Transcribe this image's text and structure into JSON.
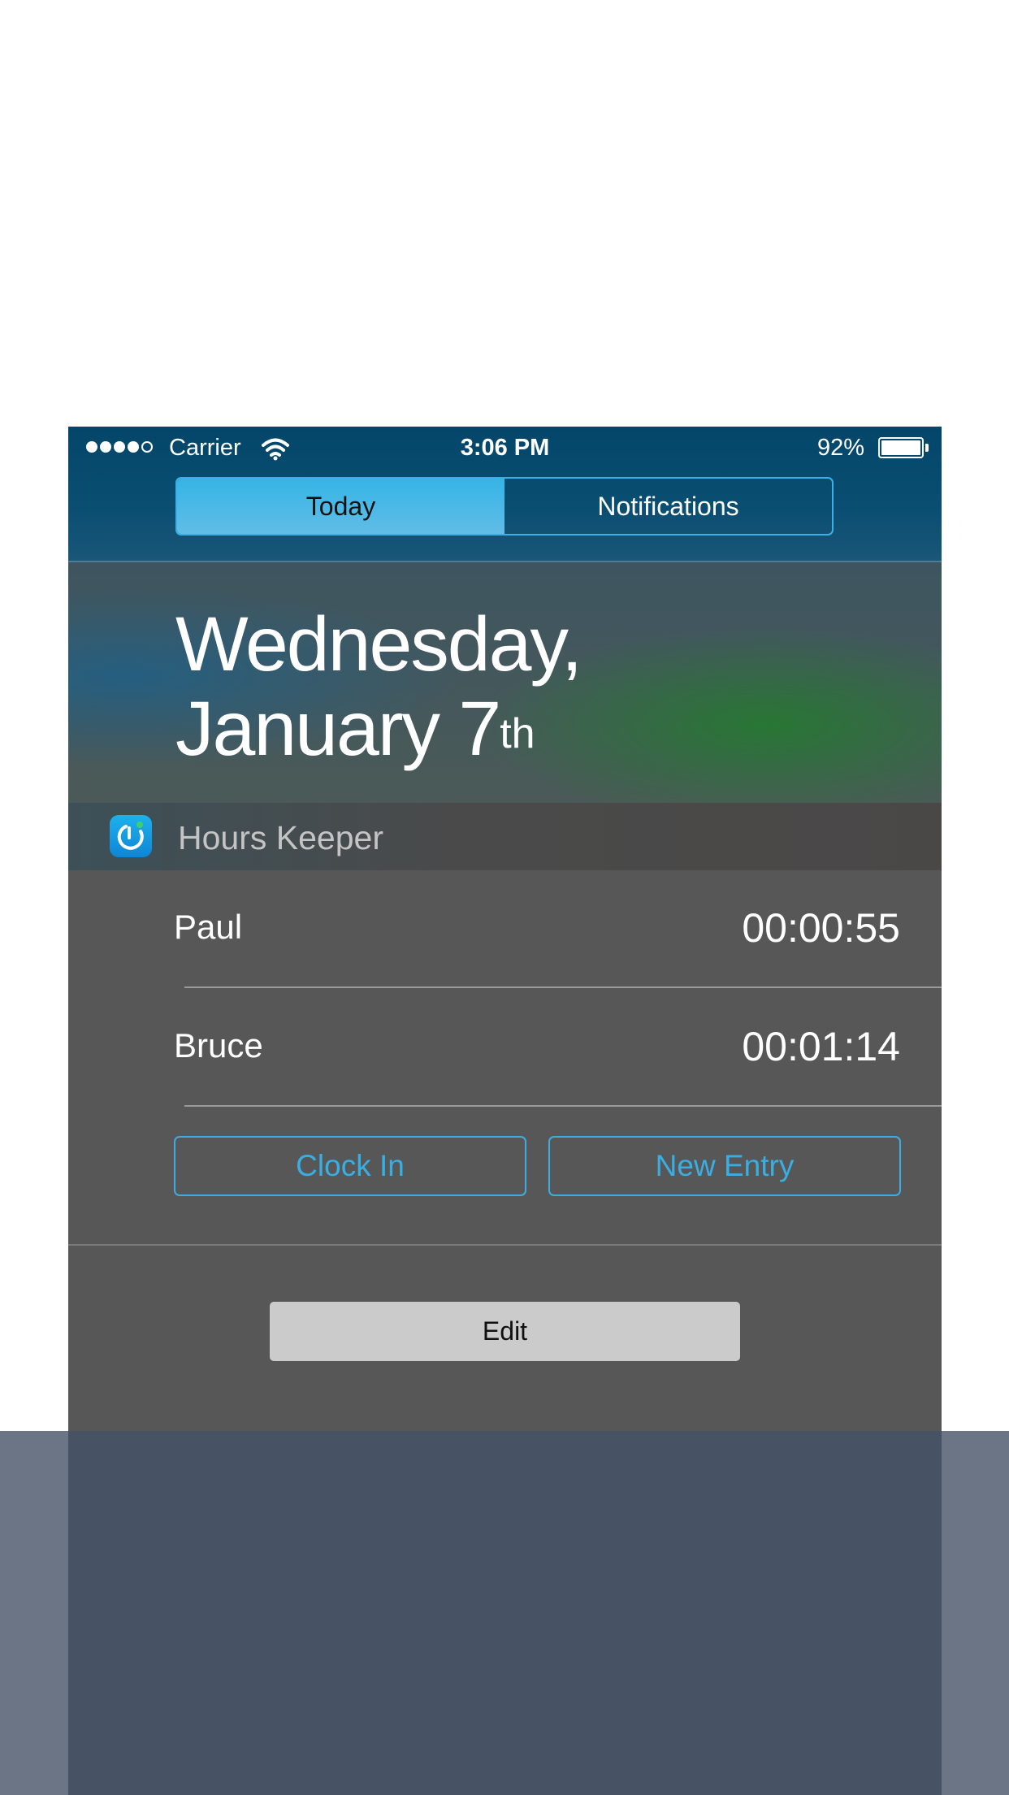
{
  "status_bar": {
    "carrier": "Carrier",
    "time": "3:06 PM",
    "battery": "92%",
    "battery_level_fraction": 0.92,
    "signal_bars": 4,
    "signal_max": 5,
    "icons": [
      "signal-dots-icon",
      "wifi-icon",
      "battery-icon"
    ]
  },
  "segments": {
    "today": "Today",
    "notifications": "Notifications",
    "selected": "Today"
  },
  "date": {
    "line1": "Wednesday,",
    "line2": "January 7",
    "suffix": "th"
  },
  "widget": {
    "app_name": "Hours Keeper",
    "app_icon": "stopwatch-icon",
    "rows": [
      {
        "name": "Paul",
        "time": "00:00:55"
      },
      {
        "name": "Bruce",
        "time": "00:01:14"
      }
    ],
    "clock_in": "Clock In",
    "new_entry": "New Entry"
  },
  "edit": "Edit",
  "colors": {
    "header": "#03466a",
    "accent": "#3aaee3",
    "widget_bg": "#575757",
    "edit_bg": "#cbcbcb",
    "lower_panel": "#475264",
    "bottom_band": "#6b7585"
  }
}
